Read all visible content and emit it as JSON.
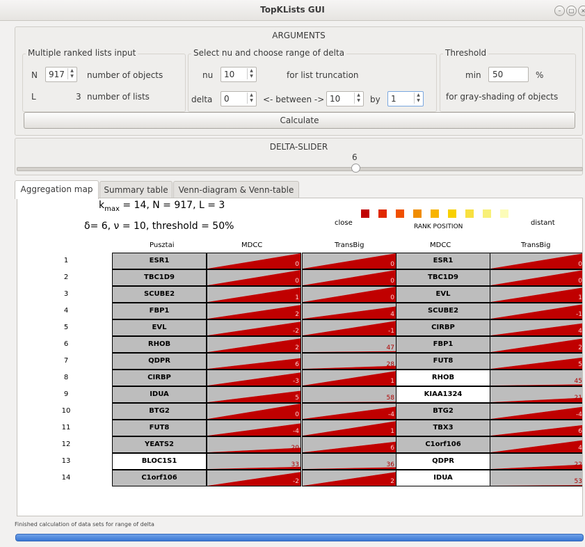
{
  "window": {
    "title": "TopKLists GUI"
  },
  "arguments": {
    "title": "ARGUMENTS",
    "input_group": "Multiple ranked lists input",
    "n_label": "N",
    "n_value": "917",
    "n_desc": "number of objects",
    "l_label": "L",
    "l_value": "3",
    "l_desc": "number of lists",
    "nu_group": "Select nu and choose range of delta",
    "nu_label": "nu",
    "nu_value": "10",
    "nu_desc": "for list truncation",
    "delta_label": "delta",
    "delta_from": "0",
    "between_label": "<- between ->",
    "delta_to": "10",
    "by_label": "by",
    "delta_by": "1",
    "threshold_group": "Threshold",
    "min_label": "min",
    "min_value": "50",
    "pct": "%",
    "threshold_desc": "for gray-shading of objects",
    "calculate": "Calculate"
  },
  "slider": {
    "title": "DELTA-SLIDER",
    "value": "6",
    "fraction": 0.6
  },
  "tabs": [
    {
      "label": "Aggregation map",
      "active": true
    },
    {
      "label": "Summary table",
      "active": false
    },
    {
      "label": "Venn-diagram & Venn-table",
      "active": false
    }
  ],
  "map": {
    "kmax_k": "k",
    "kmax_hat": "^",
    "kmax_sub": "max",
    "kmax_rest": "= 14, N = 917, L = 3",
    "params_line": "δ= 6, ν = 10, threshold = 50%",
    "legend_close": "close",
    "legend_rank": "RANK POSITION",
    "legend_distant": "distant",
    "legend_colors": [
      "#c00000",
      "#e02800",
      "#f05000",
      "#f08c00",
      "#f8b400",
      "#f8d000",
      "#f8e040",
      "#f8f078",
      "#fcfcb8"
    ],
    "headers": [
      "Pusztai",
      "MDCC",
      "TransBig",
      "MDCC",
      "TransBig"
    ],
    "rows": [
      {
        "n": "1",
        "a": "ESR1",
        "ag": true,
        "b": "0",
        "bf": 1.0,
        "c": "0",
        "cf": 1.0,
        "d": "ESR1",
        "dg": true,
        "e": "0",
        "ef": 1.0
      },
      {
        "n": "2",
        "a": "TBC1D9",
        "ag": true,
        "b": "0",
        "bf": 1.0,
        "c": "0",
        "cf": 1.0,
        "d": "TBC1D9",
        "dg": true,
        "e": "0",
        "ef": 1.0
      },
      {
        "n": "3",
        "a": "SCUBE2",
        "ag": true,
        "b": "1",
        "bf": 0.95,
        "c": "0",
        "cf": 1.0,
        "d": "EVL",
        "dg": true,
        "e": "1",
        "ef": 0.95
      },
      {
        "n": "4",
        "a": "FBP1",
        "ag": true,
        "b": "2",
        "bf": 0.9,
        "c": "4",
        "cf": 0.8,
        "d": "SCUBE2",
        "dg": true,
        "e": "-1",
        "ef": 0.95
      },
      {
        "n": "5",
        "a": "EVL",
        "ag": true,
        "b": "-2",
        "bf": 0.9,
        "c": "-1",
        "cf": 0.95,
        "d": "CIRBP",
        "dg": true,
        "e": "4",
        "ef": 0.8
      },
      {
        "n": "6",
        "a": "RHOB",
        "ag": true,
        "b": "2",
        "bf": 0.9,
        "c": "47",
        "cf": 0.06,
        "d": "FBP1",
        "dg": true,
        "e": "2",
        "ef": 0.9
      },
      {
        "n": "7",
        "a": "QDPR",
        "ag": true,
        "b": "6",
        "bf": 0.7,
        "c": "28",
        "cf": 0.2,
        "d": "FUT8",
        "dg": true,
        "e": "5",
        "ef": 0.75
      },
      {
        "n": "8",
        "a": "CIRBP",
        "ag": true,
        "b": "-3",
        "bf": 0.85,
        "c": "1",
        "cf": 0.95,
        "d": "RHOB",
        "dg": false,
        "e": "45",
        "ef": 0.08
      },
      {
        "n": "9",
        "a": "IDUA",
        "ag": true,
        "b": "5",
        "bf": 0.75,
        "c": "58",
        "cf": 0.03,
        "d": "KIAA1324",
        "dg": false,
        "e": "21",
        "ef": 0.3
      },
      {
        "n": "10",
        "a": "BTG2",
        "ag": true,
        "b": "0",
        "bf": 1.0,
        "c": "-4",
        "cf": 0.8,
        "d": "BTG2",
        "dg": true,
        "e": "-4",
        "ef": 0.8
      },
      {
        "n": "11",
        "a": "FUT8",
        "ag": true,
        "b": "-4",
        "bf": 0.8,
        "c": "1",
        "cf": 0.95,
        "d": "TBX3",
        "dg": true,
        "e": "6",
        "ef": 0.7
      },
      {
        "n": "12",
        "a": "YEATS2",
        "ag": true,
        "b": "20",
        "bf": 0.3,
        "c": "6",
        "cf": 0.7,
        "d": "C1orf106",
        "dg": true,
        "e": "4",
        "ef": 0.8
      },
      {
        "n": "13",
        "a": "BLOC1S1",
        "ag": false,
        "b": "33",
        "bf": 0.15,
        "c": "36",
        "cf": 0.12,
        "d": "QDPR",
        "dg": false,
        "e": "22",
        "ef": 0.3
      },
      {
        "n": "14",
        "a": "C1orf106",
        "ag": true,
        "b": "-2",
        "bf": 0.9,
        "c": "2",
        "cf": 0.9,
        "d": "IDUA",
        "dg": false,
        "e": "53",
        "ef": 0.04
      }
    ]
  },
  "status": {
    "text": "Finished calculation of data sets for range of delta",
    "progress": 1.0
  },
  "colors": {
    "red": "#c00000",
    "gray": "#bdbdbd",
    "progress": "#3a78d4"
  }
}
